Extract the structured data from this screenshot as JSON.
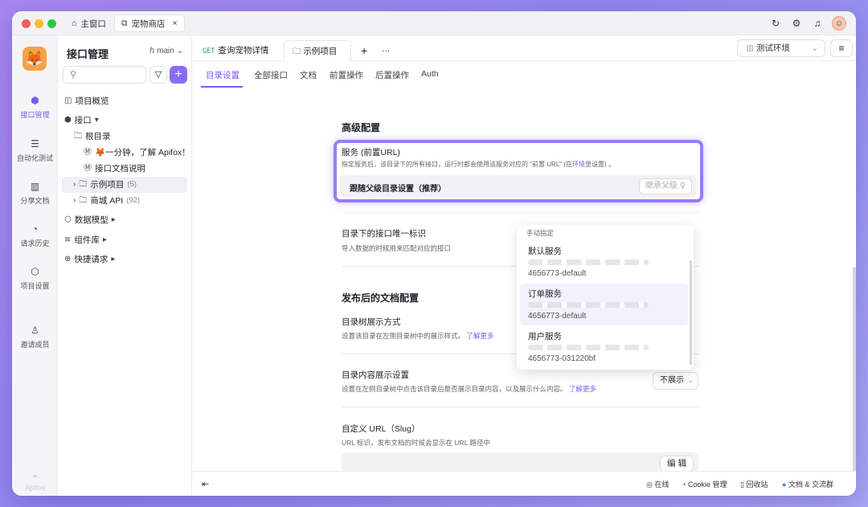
{
  "titlebar": {
    "tabs": [
      {
        "icon": "home-icon",
        "label": "主窗口"
      },
      {
        "icon": "link-icon",
        "label": "宠物商店",
        "close": "×"
      }
    ]
  },
  "rail": {
    "items": [
      {
        "icon": "api-icon",
        "label": "接口管理"
      },
      {
        "icon": "automation-icon",
        "label": "自动化测试"
      },
      {
        "icon": "book-icon",
        "label": "分享文档"
      },
      {
        "icon": "clock-icon",
        "label": "请求历史"
      },
      {
        "icon": "settings-icon",
        "label": "项目设置"
      },
      {
        "icon": "invite-icon",
        "label": "邀请成员"
      }
    ],
    "brand": "Apifox"
  },
  "sidebar": {
    "title": "接口管理",
    "branch": "main",
    "add": "+",
    "tree": [
      {
        "label": "项目概览"
      },
      {
        "label": "接口"
      },
      {
        "label": "根目录"
      },
      {
        "label": "🦊一分钟，了解 Apifox！"
      },
      {
        "label": "接口文档说明"
      },
      {
        "label": "示例项目",
        "count": "(5)"
      },
      {
        "label": "商城 API",
        "count": "(92)"
      },
      {
        "label": "数据模型"
      },
      {
        "label": "组件库"
      },
      {
        "label": "快捷请求"
      }
    ]
  },
  "tabs": {
    "get_method": "GET",
    "get_label": "查询宠物详情",
    "active_label": "示例项目",
    "plus": "+",
    "more": "···",
    "env": "测试环境"
  },
  "subtabs": [
    "目录设置",
    "全部接口",
    "文档",
    "前置操作",
    "后置操作",
    "Auth"
  ],
  "advanced": {
    "title": "高级配置",
    "service_label": "服务 (前置URL)",
    "service_desc_pre": "指定服务后，该目录下的所有接口，运行时都会使用该服务对应的 \"前置 URL\" (在",
    "service_desc_link": "环境",
    "service_desc_post": "里设置) 。",
    "service_value": "跟随父级目录设置（推荐）",
    "service_btn": "继承父级",
    "unique_label": "目录下的接口唯一标识",
    "unique_desc": "导入数据的时候用来匹配对应的接口"
  },
  "dropdown": {
    "header": "手动指定",
    "options": [
      {
        "name": "默认服务",
        "url": "4656773-default"
      },
      {
        "name": "订单服务",
        "url": "4656773-default"
      },
      {
        "name": "用户服务",
        "url": "4656773-031220bf"
      }
    ]
  },
  "published": {
    "title": "发布后的文档配置",
    "tree_label": "目录树展示方式",
    "tree_desc": "设置该目录在左侧目录树中的展示样式。",
    "more": "了解更多",
    "content_label": "目录内容展示设置",
    "content_desc": "设置在左侧目录树中点击该目录后是否展示目录内容，以及展示什么内容。",
    "content_value": "不展示",
    "slug_label": "自定义 URL（Slug）",
    "slug_desc": "URL 标识，发布文档的时候会显示在 URL 路径中",
    "edit": "编 辑"
  },
  "bottom": [
    "在线",
    "Cookie 管理",
    "回收站",
    "文档 & 交流群"
  ]
}
